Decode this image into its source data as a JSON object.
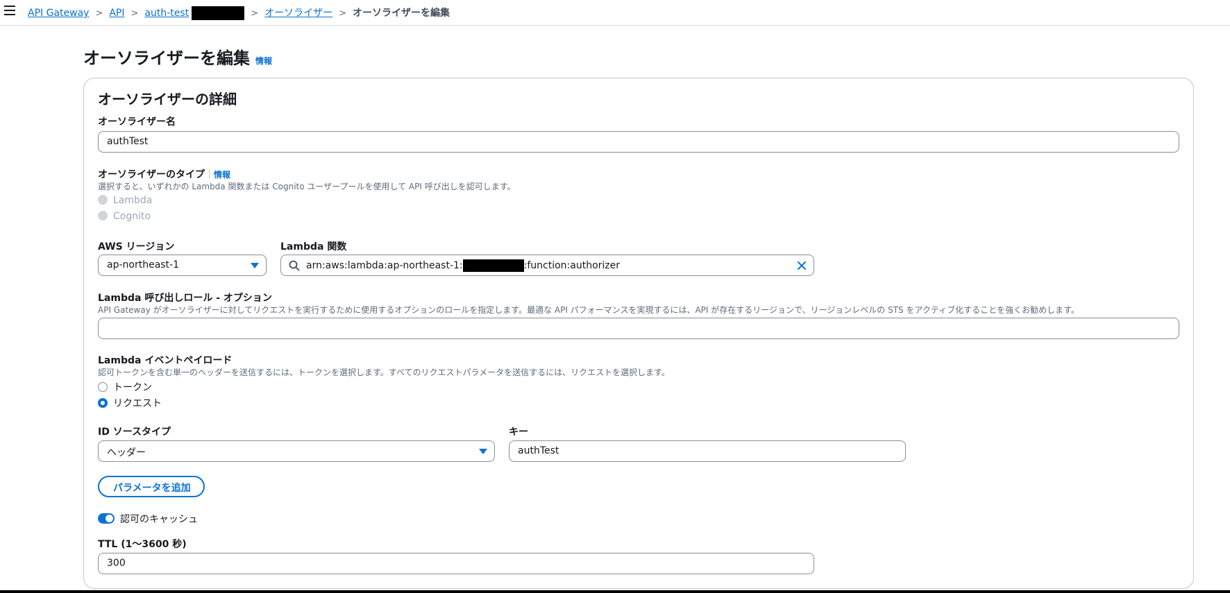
{
  "breadcrumb": {
    "items": [
      "API Gateway",
      "API",
      "auth-test",
      "オーソライザー"
    ],
    "current": "オーソライザーを編集"
  },
  "page": {
    "title": "オーソライザーを編集",
    "info": "情報"
  },
  "details": {
    "title": "オーソライザーの詳細",
    "name": {
      "label": "オーソライザー名",
      "value": "authTest"
    },
    "type": {
      "label": "オーソライザーのタイプ",
      "info": "情報",
      "desc": "選択すると、いずれかの Lambda 関数または Cognito ユーザープールを使用して API 呼び出しを認可します。",
      "options": [
        "Lambda",
        "Cognito"
      ]
    },
    "region": {
      "label": "AWS リージョン",
      "value": "ap-northeast-1"
    },
    "lambda_function": {
      "label": "Lambda 関数",
      "value_prefix": "arn:aws:lambda:ap-northeast-1:",
      "value_suffix": ":function:authorizer"
    },
    "invoke_role": {
      "label": "Lambda 呼び出しロール - オプション",
      "desc": "API Gateway がオーソライザーに対してリクエストを実行するために使用するオプションのロールを指定します。最適な API パフォーマンスを実現するには、API が存在するリージョンで、リージョンレベルの STS をアクティブ化することを強くお勧めします。",
      "value": ""
    },
    "payload": {
      "label": "Lambda イベントペイロード",
      "desc": "認可トークンを含む単一のヘッダーを送信するには、トークンを選択します。すべてのリクエストパラメータを送信するには、リクエストを選択します。",
      "options": [
        "トークン",
        "リクエスト"
      ],
      "selected": "リクエスト"
    },
    "source_type": {
      "label": "ID ソースタイプ",
      "value": "ヘッダー"
    },
    "key": {
      "label": "キー",
      "value": "authTest"
    },
    "add_param_button": "パラメータを追加",
    "cache": {
      "label": "認可のキャッシュ",
      "enabled": true
    },
    "ttl": {
      "label": "TTL (1〜3600 秒)",
      "value": "300"
    }
  },
  "colors": {
    "accent": "#0972d3",
    "text": "#16191f",
    "muted": "#5f6b7a",
    "border": "#8c8c94"
  }
}
